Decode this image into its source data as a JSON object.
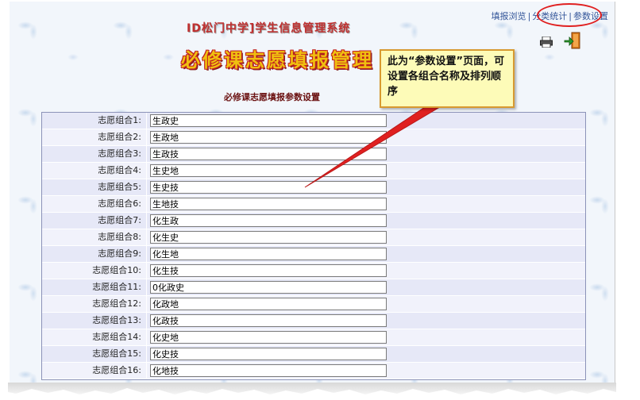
{
  "nav": {
    "links": [
      "填报浏览",
      "分类统计",
      "参数设置"
    ],
    "separator": "|"
  },
  "header": {
    "school_title": "ID松门中学]学生信息管理系统",
    "banner": "必修课志愿填报管理"
  },
  "section_title": "必修课志愿填报参数设置",
  "callout": {
    "text": "此为“参数设置”页面，可设置各组合名称及排列顺序"
  },
  "rows": [
    {
      "label": "志愿组合1:",
      "value": "生政史"
    },
    {
      "label": "志愿组合2:",
      "value": "生政地"
    },
    {
      "label": "志愿组合3:",
      "value": "生政技"
    },
    {
      "label": "志愿组合4:",
      "value": "生史地"
    },
    {
      "label": "志愿组合5:",
      "value": "生史技"
    },
    {
      "label": "志愿组合6:",
      "value": "生地技"
    },
    {
      "label": "志愿组合7:",
      "value": "化生政"
    },
    {
      "label": "志愿组合8:",
      "value": "化生史"
    },
    {
      "label": "志愿组合9:",
      "value": "化生地"
    },
    {
      "label": "志愿组合10:",
      "value": "化生技"
    },
    {
      "label": "志愿组合11:",
      "value": "0化政史"
    },
    {
      "label": "志愿组合12:",
      "value": "化政地"
    },
    {
      "label": "志愿组合13:",
      "value": "化政技"
    },
    {
      "label": "志愿组合14:",
      "value": "化史地"
    },
    {
      "label": "志愿组合15:",
      "value": "化史技"
    },
    {
      "label": "志愿组合16:",
      "value": "化地技"
    }
  ],
  "colors": {
    "accent": "#e02020",
    "callout_bg": "#fdfbb8",
    "callout_border": "#d89a30",
    "table_border": "#8c93b8"
  }
}
